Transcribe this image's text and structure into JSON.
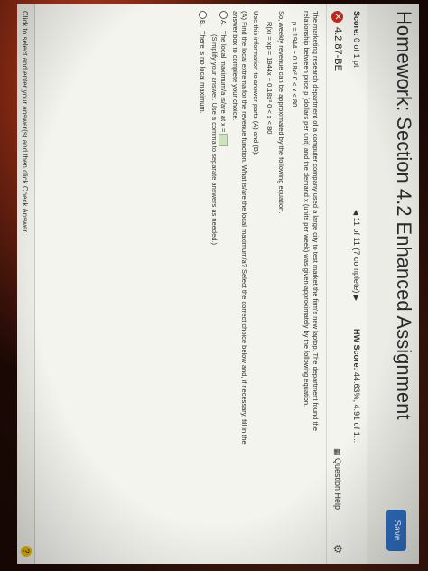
{
  "header": {
    "title": "Homework: Section 4.2 Enhanced Assignment",
    "save_label": "Save"
  },
  "status": {
    "score_label": "Score:",
    "score_value": "0 of 1 pt",
    "progress": "11 of 11 (7 complete)",
    "hw_score_label": "HW Score:",
    "hw_score_value": "44.63%, 4.91 of 1..."
  },
  "question": {
    "id": "4.2.87-BE",
    "help_label": "Question Help",
    "intro": "The marketing research department of a computer company used a large city to test market the firm's new laptop. The department found the relationship between price p (dollars per unit) and the demand x (units per week) was given approximately by the following equation.",
    "price_eq": "p = 1944 − 0.18x²   0 < x < 80",
    "revenue_intro": "So, weekly revenue can be approximated by the following equation.",
    "revenue_eq": "R(x) = xp = 1944x − 0.18x³   0 < x < 80",
    "use_info": "Use this information to answer parts (A) and (B).",
    "part_a": "(A) Find the local extrema for the revenue function. What is/are the local maximum/a? Select the correct choice below and, if necessary, fill in the answer box to complete your choice.",
    "choice_a_letter": "A.",
    "choice_a_text": "The local maximum/a is/are at x =",
    "choice_a_hint": "(Simplify your answer. Use a comma to separate answers as needed.)",
    "choice_b_letter": "B.",
    "choice_b_text": "There is no local maximum."
  },
  "footer": {
    "instruction": "Click to select and enter your answer(s) and then click Check Answer."
  },
  "icons": [
    "wrong-x-icon",
    "gear-icon",
    "question-help-icon",
    "left-arrow-icon",
    "right-arrow-icon",
    "help-icon"
  ]
}
